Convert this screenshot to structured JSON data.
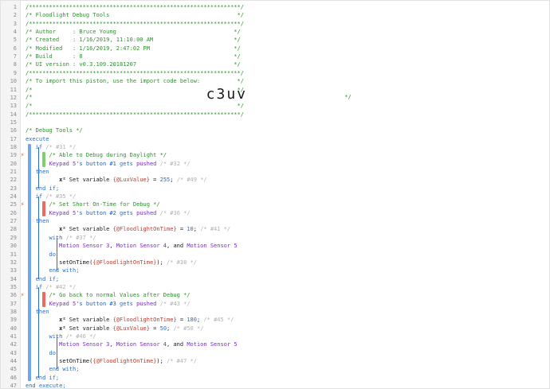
{
  "lines": [
    {
      "n": "1",
      "t": [
        [
          "/***************************************************************/",
          "cmt"
        ]
      ]
    },
    {
      "n": "2",
      "t": [
        [
          "/* Floodlight Debug Tools                                      */",
          "cmt"
        ]
      ]
    },
    {
      "n": "3",
      "t": [
        [
          "/***************************************************************/",
          "cmt"
        ]
      ]
    },
    {
      "n": "4",
      "t": [
        [
          "/* Author     : Bruce Young                                   */",
          "cmt"
        ]
      ]
    },
    {
      "n": "5",
      "t": [
        [
          "/* Created    : 1/16/2019, 11:10:00 AM                        */",
          "cmt"
        ]
      ]
    },
    {
      "n": "6",
      "t": [
        [
          "/* Modified   : 1/16/2019, 2:47:02 PM                         */",
          "cmt"
        ]
      ]
    },
    {
      "n": "7",
      "t": [
        [
          "/* Build      : 8                                             */",
          "cmt"
        ]
      ]
    },
    {
      "n": "8",
      "t": [
        [
          "/* UI version : v0.3.109.20181207                             */",
          "cmt"
        ]
      ]
    },
    {
      "n": "9",
      "t": [
        [
          "/***************************************************************/",
          "cmt"
        ]
      ]
    },
    {
      "n": "10",
      "t": [
        [
          "/* To import this piston, use the import code below:           */",
          "cmt"
        ]
      ]
    },
    {
      "n": "11",
      "t": [
        [
          "/*                                                             */",
          "cmt"
        ]
      ]
    },
    {
      "n": "12",
      "t": [
        [
          "/*",
          "cmt"
        ],
        [
          "                 c3uv",
          "big"
        ],
        [
          "                             */",
          "cmt"
        ]
      ]
    },
    {
      "n": "13",
      "t": [
        [
          "/*                                                             */",
          "cmt"
        ]
      ]
    },
    {
      "n": "14",
      "t": [
        [
          "/***************************************************************/",
          "cmt"
        ]
      ]
    },
    {
      "n": "15",
      "t": []
    },
    {
      "n": "16",
      "t": [
        [
          "/* Debug Tools */",
          "cmt"
        ]
      ]
    },
    {
      "n": "17",
      "t": [
        [
          "execute",
          "kw"
        ]
      ]
    },
    {
      "n": "18",
      "t": [
        [
          "   if ",
          "kw"
        ],
        [
          "/* #31 */",
          "gray"
        ]
      ]
    },
    {
      "n": "19",
      "t": [
        [
          "       /* Able to Debug during Daylight */",
          "cmt"
        ]
      ]
    },
    {
      "n": "20",
      "t": [
        [
          "       Keypad 5",
          "dev"
        ],
        [
          "'s ",
          "blue"
        ],
        [
          "button #1",
          "blue"
        ],
        [
          " gets ",
          "kw"
        ],
        [
          "pushed",
          "dev"
        ],
        [
          " /* #32 */",
          "gray"
        ]
      ]
    },
    {
      "n": "21",
      "t": [
        [
          "   then",
          "kw"
        ]
      ]
    },
    {
      "n": "22",
      "t": [
        [
          "          x² ",
          "xsq"
        ],
        [
          "Set variable ",
          ""
        ],
        [
          "{@LuxValue}",
          "var"
        ],
        [
          " = ",
          ""
        ],
        [
          "255",
          "num"
        ],
        [
          "; ",
          ""
        ],
        [
          "/* #49 */",
          "gray"
        ]
      ]
    },
    {
      "n": "23",
      "t": [
        [
          "   end if;",
          "kw"
        ]
      ]
    },
    {
      "n": "24",
      "t": [
        [
          "   if ",
          "kw"
        ],
        [
          "/* #35 */",
          "gray"
        ]
      ]
    },
    {
      "n": "25",
      "t": [
        [
          "       /* Set Short On-Time for Debug */",
          "cmt"
        ]
      ]
    },
    {
      "n": "26",
      "t": [
        [
          "       Keypad 5",
          "dev"
        ],
        [
          "'s ",
          "blue"
        ],
        [
          "button #2",
          "blue"
        ],
        [
          " gets ",
          "kw"
        ],
        [
          "pushed",
          "dev"
        ],
        [
          " /* #36 */",
          "gray"
        ]
      ]
    },
    {
      "n": "27",
      "t": [
        [
          "   then",
          "kw"
        ]
      ]
    },
    {
      "n": "28",
      "t": [
        [
          "          x² ",
          "xsq"
        ],
        [
          "Set variable ",
          ""
        ],
        [
          "{@FloodlightOnTime}",
          "var"
        ],
        [
          " = ",
          ""
        ],
        [
          "10",
          "num"
        ],
        [
          "; ",
          ""
        ],
        [
          "/* #41 */",
          "gray"
        ]
      ]
    },
    {
      "n": "29",
      "t": [
        [
          "       with ",
          "kw"
        ],
        [
          "/* #37 */",
          "gray"
        ]
      ]
    },
    {
      "n": "30",
      "t": [
        [
          "          Motion Sensor 3",
          "dev"
        ],
        [
          ", ",
          ""
        ],
        [
          "Motion Sensor 4",
          "dev"
        ],
        [
          ", and ",
          ""
        ],
        [
          "Motion Sensor 5",
          "dev"
        ]
      ]
    },
    {
      "n": "31",
      "t": [
        [
          "       do",
          "kw"
        ]
      ]
    },
    {
      "n": "32",
      "t": [
        [
          "          setOnTime(",
          ""
        ],
        [
          "{@FloodlightOnTime}",
          "var"
        ],
        [
          ");",
          ""
        ],
        [
          " /* #38 */",
          "gray"
        ]
      ]
    },
    {
      "n": "33",
      "t": [
        [
          "       end with;",
          "kw"
        ]
      ]
    },
    {
      "n": "34",
      "t": [
        [
          "   end if;",
          "kw"
        ]
      ]
    },
    {
      "n": "35",
      "t": [
        [
          "   if ",
          "kw"
        ],
        [
          "/* #42 */",
          "gray"
        ]
      ]
    },
    {
      "n": "36",
      "t": [
        [
          "       /* Go back to normal Values after Debug */",
          "cmt"
        ]
      ]
    },
    {
      "n": "37",
      "t": [
        [
          "       Keypad 5",
          "dev"
        ],
        [
          "'s ",
          "blue"
        ],
        [
          "button #3",
          "blue"
        ],
        [
          " gets ",
          "kw"
        ],
        [
          "pushed",
          "dev"
        ],
        [
          " /* #43 */",
          "gray"
        ]
      ]
    },
    {
      "n": "38",
      "t": [
        [
          "   then",
          "kw"
        ]
      ]
    },
    {
      "n": "39",
      "t": [
        [
          "          x² ",
          "xsq"
        ],
        [
          "Set variable ",
          ""
        ],
        [
          "{@FloodlightOnTime}",
          "var"
        ],
        [
          " = ",
          ""
        ],
        [
          "180",
          "num"
        ],
        [
          "; ",
          ""
        ],
        [
          "/* #45 */",
          "gray"
        ]
      ]
    },
    {
      "n": "40",
      "t": [
        [
          "          x² ",
          "xsq"
        ],
        [
          "Set variable ",
          ""
        ],
        [
          "{@LuxValue}",
          "var"
        ],
        [
          " = ",
          ""
        ],
        [
          "50",
          "num"
        ],
        [
          "; ",
          ""
        ],
        [
          "/* #50 */",
          "gray"
        ]
      ]
    },
    {
      "n": "41",
      "t": [
        [
          "       with ",
          "kw"
        ],
        [
          "/* #46 */",
          "gray"
        ]
      ]
    },
    {
      "n": "42",
      "t": [
        [
          "          Motion Sensor 3",
          "dev"
        ],
        [
          ", ",
          ""
        ],
        [
          "Motion Sensor 4",
          "dev"
        ],
        [
          ", and ",
          ""
        ],
        [
          "Motion Sensor 5",
          "dev"
        ]
      ]
    },
    {
      "n": "43",
      "t": [
        [
          "       do",
          "kw"
        ]
      ]
    },
    {
      "n": "44",
      "t": [
        [
          "          setOnTime(",
          ""
        ],
        [
          "{@FloodlightOnTime}",
          "var"
        ],
        [
          ");",
          ""
        ],
        [
          " /* #47 */",
          "gray"
        ]
      ]
    },
    {
      "n": "45",
      "t": [
        [
          "       end with;",
          "kw"
        ]
      ]
    },
    {
      "n": "46",
      "t": [
        [
          "   end if;",
          "kw"
        ]
      ]
    },
    {
      "n": "47",
      "t": [
        [
          "end execute;",
          "kw"
        ]
      ]
    }
  ],
  "trigger_icon": "flash-icon",
  "trigger_lines": [
    "19",
    "25",
    "36"
  ]
}
